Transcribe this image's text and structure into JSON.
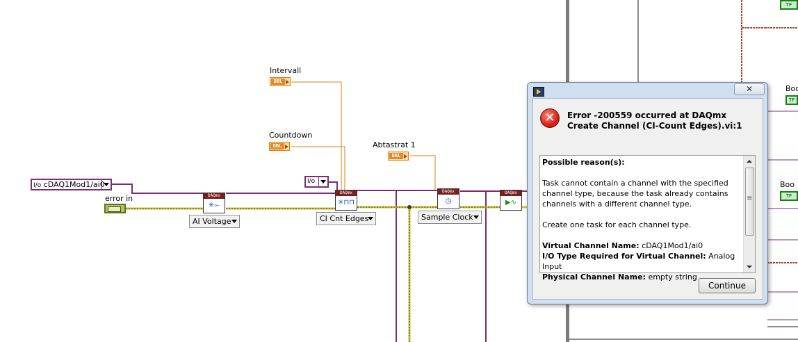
{
  "diagram": {
    "labels": {
      "intervall": "Intervall",
      "countdown": "Countdown",
      "abtastrat": "Abtastrat 1",
      "error_in": "error in"
    },
    "constants": {
      "dbl_tag": "DBL",
      "daqmx_tag": "DAQmx"
    },
    "channel_control": {
      "value": "cDAQ1Mod1/ai0",
      "prefix": "I/o"
    },
    "small_ring": {
      "value": "I/o"
    },
    "selectors": {
      "ai_voltage": "AI Voltage",
      "ci_cnt_edges": "CI Cnt Edges",
      "sample_clock": "Sample Clock"
    },
    "right_labels": {
      "bool1": "Boo",
      "bool2": "Boo",
      "tf": "TF"
    }
  },
  "dialog": {
    "title": "Error -200559 occurred at DAQmx Create Channel (CI-Count Edges).vi:1",
    "close_label": "✕",
    "message": {
      "heading": "Possible reason(s):",
      "paragraph1": "Task cannot contain a channel with the specified channel type, because the task already contains channels with a different channel type.",
      "paragraph2": "Create one task for each channel type.",
      "details": [
        {
          "label": "Virtual Channel Name:",
          "value": "cDAQ1Mod1/ai0"
        },
        {
          "label": "I/O Type Required for Virtual Channel:",
          "value": "Analog Input"
        },
        {
          "label": "Physical Channel Name:",
          "value": "empty string"
        }
      ]
    },
    "continue_label": "Continue"
  }
}
